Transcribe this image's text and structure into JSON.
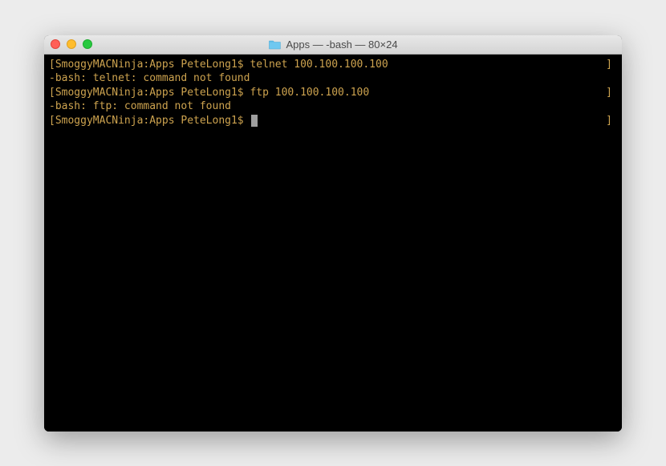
{
  "window": {
    "title": "Apps — -bash — 80×24"
  },
  "terminal": {
    "lines": [
      {
        "left_bracket": "[",
        "prompt": "SmoggyMACNinja:Apps PeteLong1$ ",
        "command": "telnet 100.100.100.100",
        "right_bracket": "]"
      },
      {
        "text": "-bash: telnet: command not found"
      },
      {
        "left_bracket": "[",
        "prompt": "SmoggyMACNinja:Apps PeteLong1$ ",
        "command": "ftp 100.100.100.100",
        "right_bracket": "]"
      },
      {
        "text": "-bash: ftp: command not found"
      },
      {
        "left_bracket": "[",
        "prompt": "SmoggyMACNinja:Apps PeteLong1$ ",
        "cursor": true,
        "right_bracket": "]"
      }
    ]
  }
}
